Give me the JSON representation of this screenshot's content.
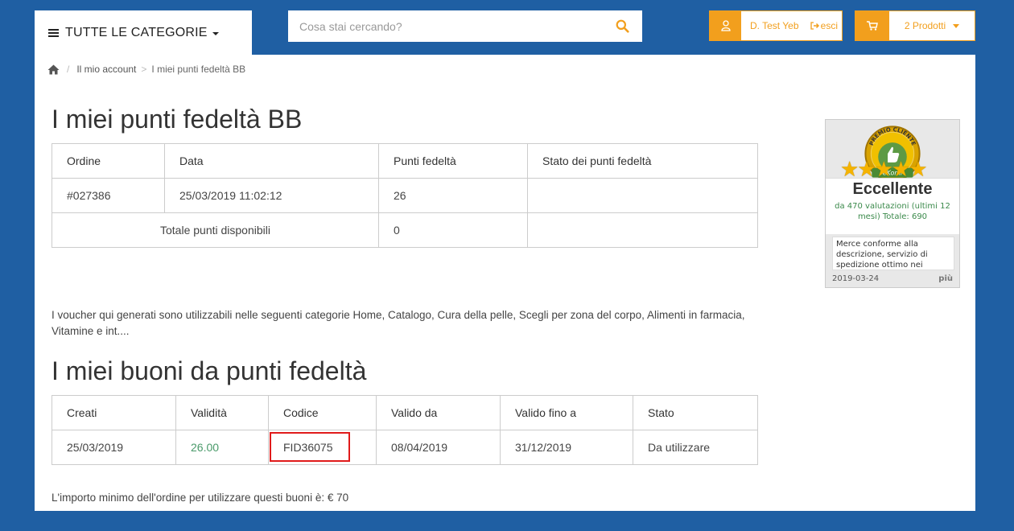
{
  "header": {
    "categories_label": "TUTTE LE CATEGORIE",
    "search_placeholder": "Cosa stai cercando?",
    "user_name": "D. Test Yeb",
    "logout_label": "esci",
    "cart_label": "2 Prodotti"
  },
  "breadcrumb": {
    "sep1": "/",
    "account": "Il mio account",
    "sep2": ">",
    "current": "I miei punti fedeltà BB"
  },
  "points": {
    "title": "I miei punti fedeltà BB",
    "headers": [
      "Ordine",
      "Data",
      "Punti fedeltà",
      "Stato dei punti fedeltà"
    ],
    "row": {
      "order": "#027386",
      "date": "25/03/2019 11:02:12",
      "points": "26",
      "status": ""
    },
    "total_label": "Totale punti disponibili",
    "total_value": "0"
  },
  "voucher_note": "I voucher qui generati sono utilizzabili nelle seguenti categorie Home, Catalogo, Cura della pelle, Scegli per zona del corpo, Alimenti in farmacia, Vitamine e int....",
  "vouchers": {
    "title": "I miei buoni da punti fedeltà",
    "headers": [
      "Creati",
      "Validità",
      "Codice",
      "Valido da",
      "Valido fino a",
      "Stato"
    ],
    "row": {
      "created": "25/03/2019",
      "validity": "26.00",
      "code": "FID36075",
      "valid_from": "08/04/2019",
      "valid_to": "31/12/2019",
      "status": "Da utilizzare"
    }
  },
  "min_order": "L'importo minimo dell'ordine per utilizzare questi buoni è: € 70",
  "ekomi": {
    "badge_top": "PREMIO CLIENTE",
    "badge_bottom": "eKomi",
    "rating_word": "Eccellente",
    "subtitle": "da 470 valutazioni (ultimi 12 mesi) Totale: 690",
    "review": "Merce conforme alla descrizione, servizio di spedizione ottimo nei",
    "date": "2019-03-24",
    "more": "più"
  },
  "colors": {
    "brand_blue": "#1f5fa3",
    "accent_orange": "#f29f1d",
    "highlight_red": "#e01b1b"
  }
}
